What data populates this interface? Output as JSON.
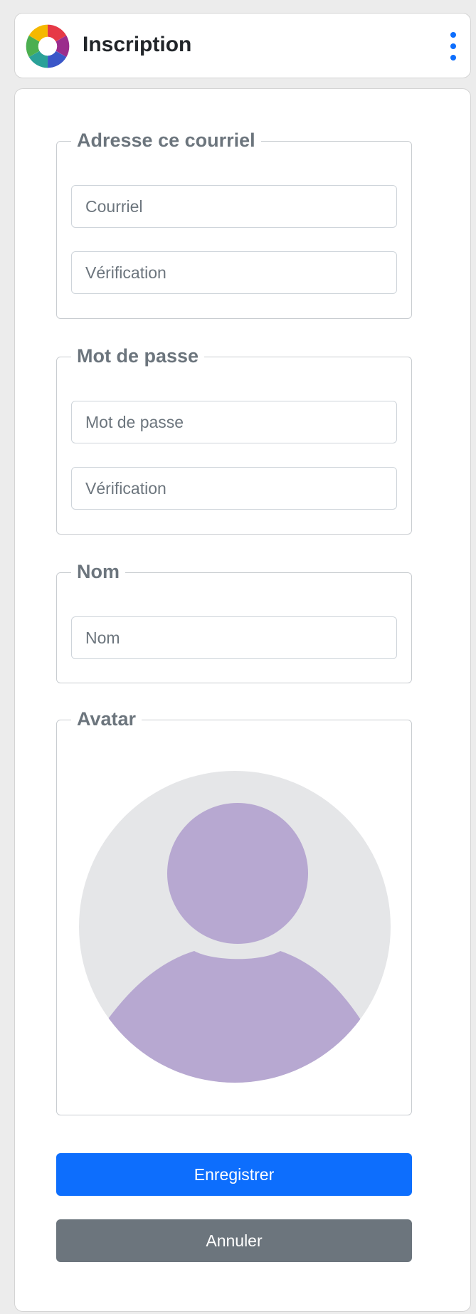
{
  "header": {
    "title": "Inscription",
    "logo_icon": "aperture-logo-icon",
    "menu_icon": "kebab-menu-icon",
    "accent_color": "#0d6efd"
  },
  "form": {
    "email_group": {
      "legend": "Adresse ce courriel",
      "email": {
        "placeholder": "Courriel",
        "value": ""
      },
      "email_verify": {
        "placeholder": "Vérification",
        "value": ""
      }
    },
    "password_group": {
      "legend": "Mot de passe",
      "password": {
        "placeholder": "Mot de passe",
        "value": ""
      },
      "password_verify": {
        "placeholder": "Vérification",
        "value": ""
      }
    },
    "name_group": {
      "legend": "Nom",
      "name": {
        "placeholder": "Nom",
        "value": ""
      }
    },
    "avatar_group": {
      "legend": "Avatar",
      "avatar_icon": "default-user-avatar-icon"
    }
  },
  "actions": {
    "save_label": "Enregistrer",
    "cancel_label": "Annuler",
    "primary_color": "#0d6efd",
    "secondary_color": "#6c757d"
  }
}
